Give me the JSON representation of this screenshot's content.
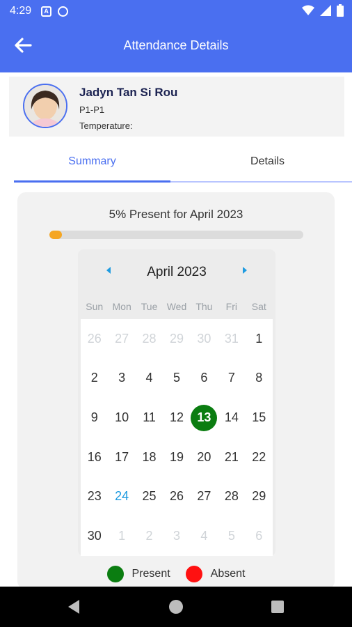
{
  "status_bar": {
    "time": "4:29"
  },
  "header": {
    "title": "Attendance Details"
  },
  "student": {
    "name": "Jadyn Tan Si Rou",
    "class": "P1-P1",
    "temperature_label": "Temperature:"
  },
  "tabs": [
    {
      "label": "Summary",
      "active": true
    },
    {
      "label": "Details",
      "active": false
    }
  ],
  "summary": {
    "present_text": "5% Present for April 2023",
    "present_fraction": 0.05
  },
  "calendar": {
    "month_label": "April 2023",
    "weekdays": [
      "Sun",
      "Mon",
      "Tue",
      "Wed",
      "Thu",
      "Fri",
      "Sat"
    ],
    "days": [
      {
        "label": "26",
        "state": "muted"
      },
      {
        "label": "27",
        "state": "muted"
      },
      {
        "label": "28",
        "state": "muted"
      },
      {
        "label": "29",
        "state": "muted"
      },
      {
        "label": "30",
        "state": "muted"
      },
      {
        "label": "31",
        "state": "muted"
      },
      {
        "label": "1",
        "state": "normal"
      },
      {
        "label": "2",
        "state": "normal"
      },
      {
        "label": "3",
        "state": "normal"
      },
      {
        "label": "4",
        "state": "normal"
      },
      {
        "label": "5",
        "state": "normal"
      },
      {
        "label": "6",
        "state": "normal"
      },
      {
        "label": "7",
        "state": "normal"
      },
      {
        "label": "8",
        "state": "normal"
      },
      {
        "label": "9",
        "state": "normal"
      },
      {
        "label": "10",
        "state": "normal"
      },
      {
        "label": "11",
        "state": "normal"
      },
      {
        "label": "12",
        "state": "normal"
      },
      {
        "label": "13",
        "state": "present"
      },
      {
        "label": "14",
        "state": "normal"
      },
      {
        "label": "15",
        "state": "normal"
      },
      {
        "label": "16",
        "state": "normal"
      },
      {
        "label": "17",
        "state": "normal"
      },
      {
        "label": "18",
        "state": "normal"
      },
      {
        "label": "19",
        "state": "normal"
      },
      {
        "label": "20",
        "state": "normal"
      },
      {
        "label": "21",
        "state": "normal"
      },
      {
        "label": "22",
        "state": "normal"
      },
      {
        "label": "23",
        "state": "normal"
      },
      {
        "label": "24",
        "state": "today"
      },
      {
        "label": "25",
        "state": "normal"
      },
      {
        "label": "26",
        "state": "normal"
      },
      {
        "label": "27",
        "state": "normal"
      },
      {
        "label": "28",
        "state": "normal"
      },
      {
        "label": "29",
        "state": "normal"
      },
      {
        "label": "30",
        "state": "normal"
      },
      {
        "label": "1",
        "state": "muted"
      },
      {
        "label": "2",
        "state": "muted"
      },
      {
        "label": "3",
        "state": "muted"
      },
      {
        "label": "4",
        "state": "muted"
      },
      {
        "label": "5",
        "state": "muted"
      },
      {
        "label": "6",
        "state": "muted"
      }
    ]
  },
  "legend": {
    "present_label": "Present",
    "absent_label": "Absent",
    "present_color": "#0b7d11",
    "absent_color": "#ff1111"
  },
  "colors": {
    "primary": "#4a6ff0",
    "progress": "#f5a623",
    "today": "#1e9be0"
  },
  "icons": {
    "back": "arrow-left-icon",
    "prev_month": "caret-left-icon",
    "next_month": "caret-right-icon"
  }
}
